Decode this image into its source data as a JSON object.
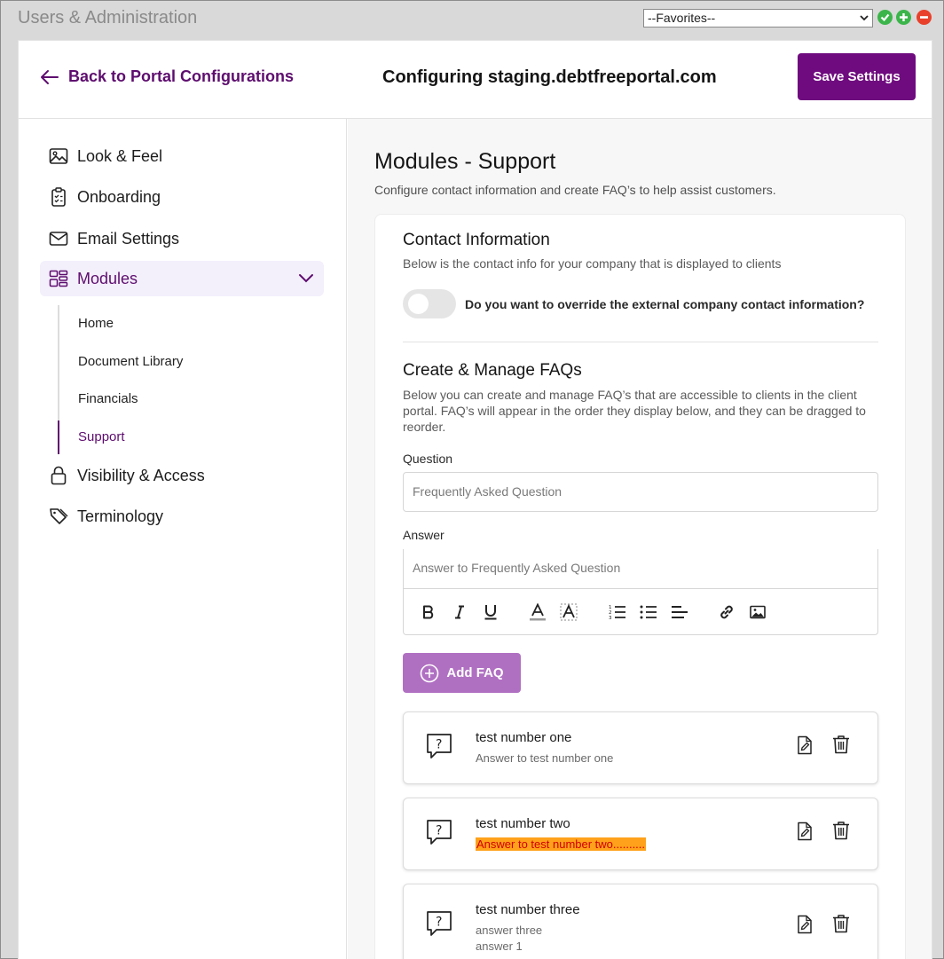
{
  "topbar": {
    "title": "Users & Administration",
    "favorites_value": "--Favorites--",
    "colors": {
      "ok": "#3bb54a",
      "add": "#3bb54a",
      "remove": "#e8402a"
    }
  },
  "header": {
    "back_label": "Back to Portal Configurations",
    "title": "Configuring staging.debtfreeportal.com",
    "save_label": "Save Settings",
    "accent": "#6f0b7f"
  },
  "sidebar": {
    "items": [
      {
        "label": "Look & Feel",
        "icon": "image-icon"
      },
      {
        "label": "Onboarding",
        "icon": "clipboard-checklist-icon"
      },
      {
        "label": "Email Settings",
        "icon": "envelope-icon"
      },
      {
        "label": "Modules",
        "icon": "modules-grid-icon",
        "expanded": true
      },
      {
        "label": "Visibility & Access",
        "icon": "lock-icon"
      },
      {
        "label": "Terminology",
        "icon": "tag-icon"
      }
    ],
    "sub_items": [
      {
        "label": "Home"
      },
      {
        "label": "Document Library"
      },
      {
        "label": "Financials"
      },
      {
        "label": "Support",
        "active": true
      }
    ]
  },
  "main": {
    "title": "Modules - Support",
    "description": "Configure contact information and create FAQ’s to help assist customers.",
    "contact": {
      "title": "Contact Information",
      "description": "Below is the contact info for your company that is displayed to clients",
      "toggle_label": "Do you want to override the external company contact information?",
      "toggle_on": false
    },
    "faqs": {
      "title": "Create & Manage FAQs",
      "description": "Below you can create and manage FAQ’s that are accessible to clients in the client portal. FAQ’s will appear in the order they display below, and they can be dragged to reorder.",
      "question_label": "Question",
      "question_placeholder": "Frequently Asked Question",
      "answer_label": "Answer",
      "answer_placeholder": "Answer to Frequently Asked Question",
      "toolbar": [
        "bold-icon",
        "italic-icon",
        "underline-icon",
        "text-color-icon",
        "highlight-icon",
        "ordered-list-icon",
        "bullet-list-icon",
        "align-left-icon",
        "link-icon",
        "image-icon"
      ],
      "add_label": "Add FAQ",
      "items": [
        {
          "question": "test number one",
          "answer": "Answer to test number one"
        },
        {
          "question": "test number two",
          "answer": "Answer to test number two..........",
          "highlighted": true
        },
        {
          "question": "test number three",
          "answer": "answer three",
          "answer_extra": "answer 1"
        }
      ]
    }
  }
}
